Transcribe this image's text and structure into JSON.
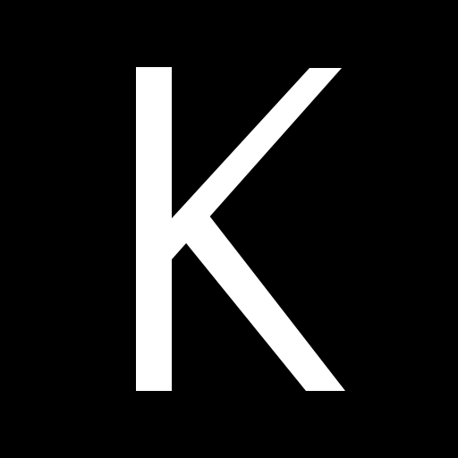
{
  "logo": {
    "letter": "K",
    "foreground_color": "#FFFFFF",
    "background_color": "#000000"
  }
}
